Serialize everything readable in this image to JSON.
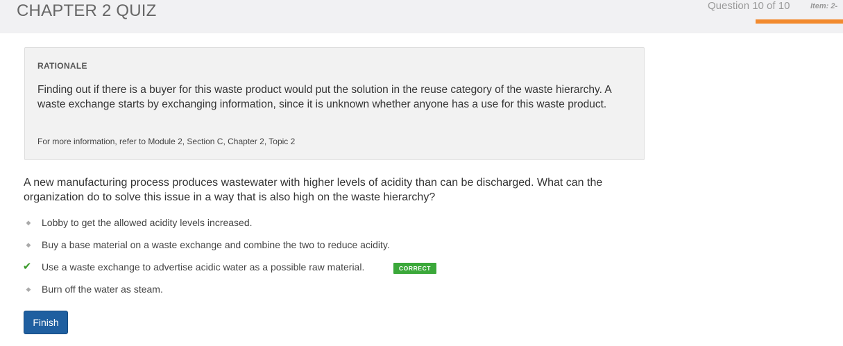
{
  "header": {
    "title": "CHAPTER 2 QUIZ",
    "progress_text": "Question 10 of 10",
    "item_label": "Item: 2-",
    "progress_fraction": 1.0,
    "progress_color": "#f28a2e"
  },
  "rationale": {
    "heading": "RATIONALE",
    "body": "Finding out if there is a buyer for this waste product would put the solution in the reuse category of the waste hierarchy. A waste exchange starts by exchanging information, since it is unknown whether anyone has a use for this waste product.",
    "reference": "For more information, refer to Module 2, Section C, Chapter 2, Topic 2"
  },
  "question": {
    "text": "A new manufacturing process produces wastewater with higher levels of acidity than can be discharged. What can the organization do to solve this issue in a way that is also high on the waste hierarchy?"
  },
  "answers": [
    {
      "label": "Lobby to get the allowed acidity levels increased.",
      "marker": "diamond-icon"
    },
    {
      "label": "Buy a base material on a waste exchange and combine the two to reduce acidity.",
      "marker": "diamond-icon"
    },
    {
      "label": "Use a waste exchange to advertise acidic water as a possible raw material.",
      "marker": "checkmark-icon",
      "correct": true,
      "badge": "CORRECT"
    },
    {
      "label": "Burn off the water as steam.",
      "marker": "diamond-icon"
    }
  ],
  "colors": {
    "correct": "#3ba83a",
    "primary_button": "#1f5fa0"
  },
  "finish_button": {
    "label": "Finish"
  }
}
